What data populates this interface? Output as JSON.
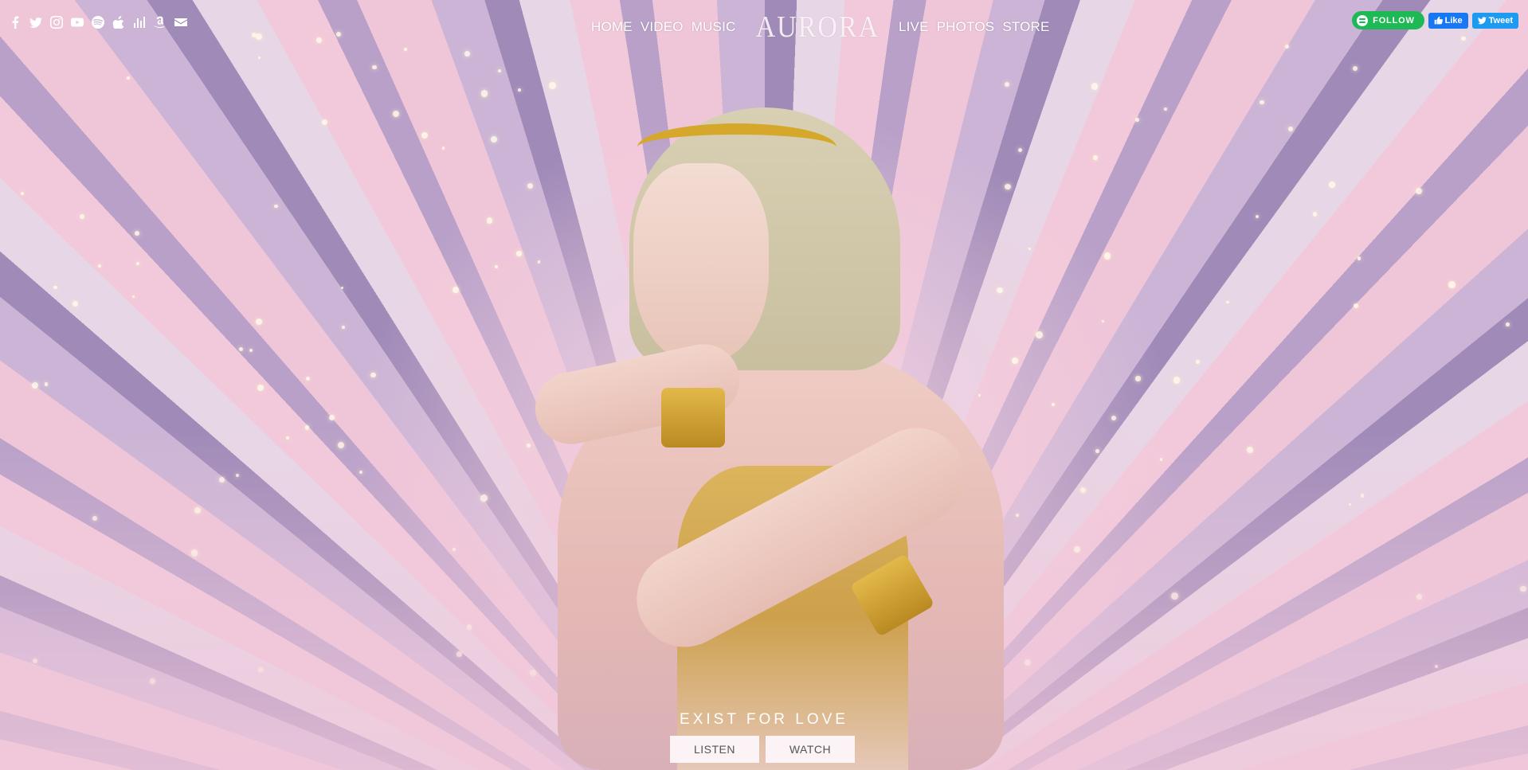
{
  "social_icons": [
    {
      "icon": "facebook-icon",
      "label": "Facebook"
    },
    {
      "icon": "twitter-icon",
      "label": "Twitter"
    },
    {
      "icon": "instagram-icon",
      "label": "Instagram"
    },
    {
      "icon": "youtube-icon",
      "label": "YouTube"
    },
    {
      "icon": "spotify-icon",
      "label": "Spotify"
    },
    {
      "icon": "apple-icon",
      "label": "Apple Music"
    },
    {
      "icon": "deezer-icon",
      "label": "Deezer"
    },
    {
      "icon": "amazon-icon",
      "label": "Amazon"
    },
    {
      "icon": "mail-icon",
      "label": "Email"
    }
  ],
  "nav": {
    "left": [
      "HOME",
      "VIDEO",
      "MUSIC"
    ],
    "logo": "AURORA",
    "right": [
      "LIVE",
      "PHOTOS",
      "STORE"
    ]
  },
  "share": {
    "spotify_follow": "FOLLOW",
    "facebook_like": "Like",
    "tweet": "Tweet"
  },
  "hero": {
    "title": "EXIST FOR LOVE",
    "listen": "LISTEN",
    "watch": "WATCH"
  },
  "colors": {
    "spotify_green": "#1db954",
    "facebook_blue": "#1877f2",
    "twitter_blue": "#1d9bf0",
    "nav_text": "#ffffff",
    "button_bg": "#fbf3f6"
  }
}
